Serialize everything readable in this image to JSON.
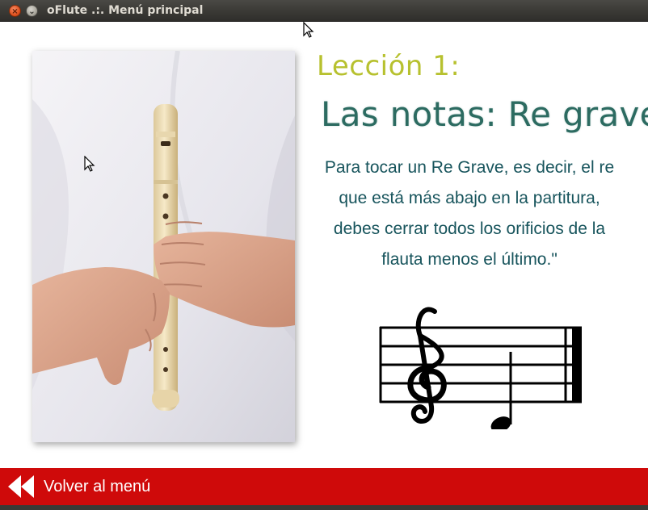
{
  "window": {
    "title": "oFlute .:. Menú principal",
    "close_glyph": "×",
    "minimize_glyph": "⌄"
  },
  "lesson": {
    "label": "Lección 1:",
    "title": "Las notas: Re grave",
    "body": "Para tocar un Re Grave, es decir, el re que está más abajo en la partitura, debes cerrar todos los orificios de la flauta menos el último.\""
  },
  "navigation": {
    "back_label": "Volver al menú"
  },
  "colors": {
    "lesson_label": "#b7c12f",
    "lesson_title": "#2c6b61",
    "body_text": "#17545c",
    "bottom_bar": "#cf0a0a"
  },
  "icons": {
    "back": "rewind-icon",
    "close": "close-icon",
    "minimize": "minimize-icon"
  }
}
